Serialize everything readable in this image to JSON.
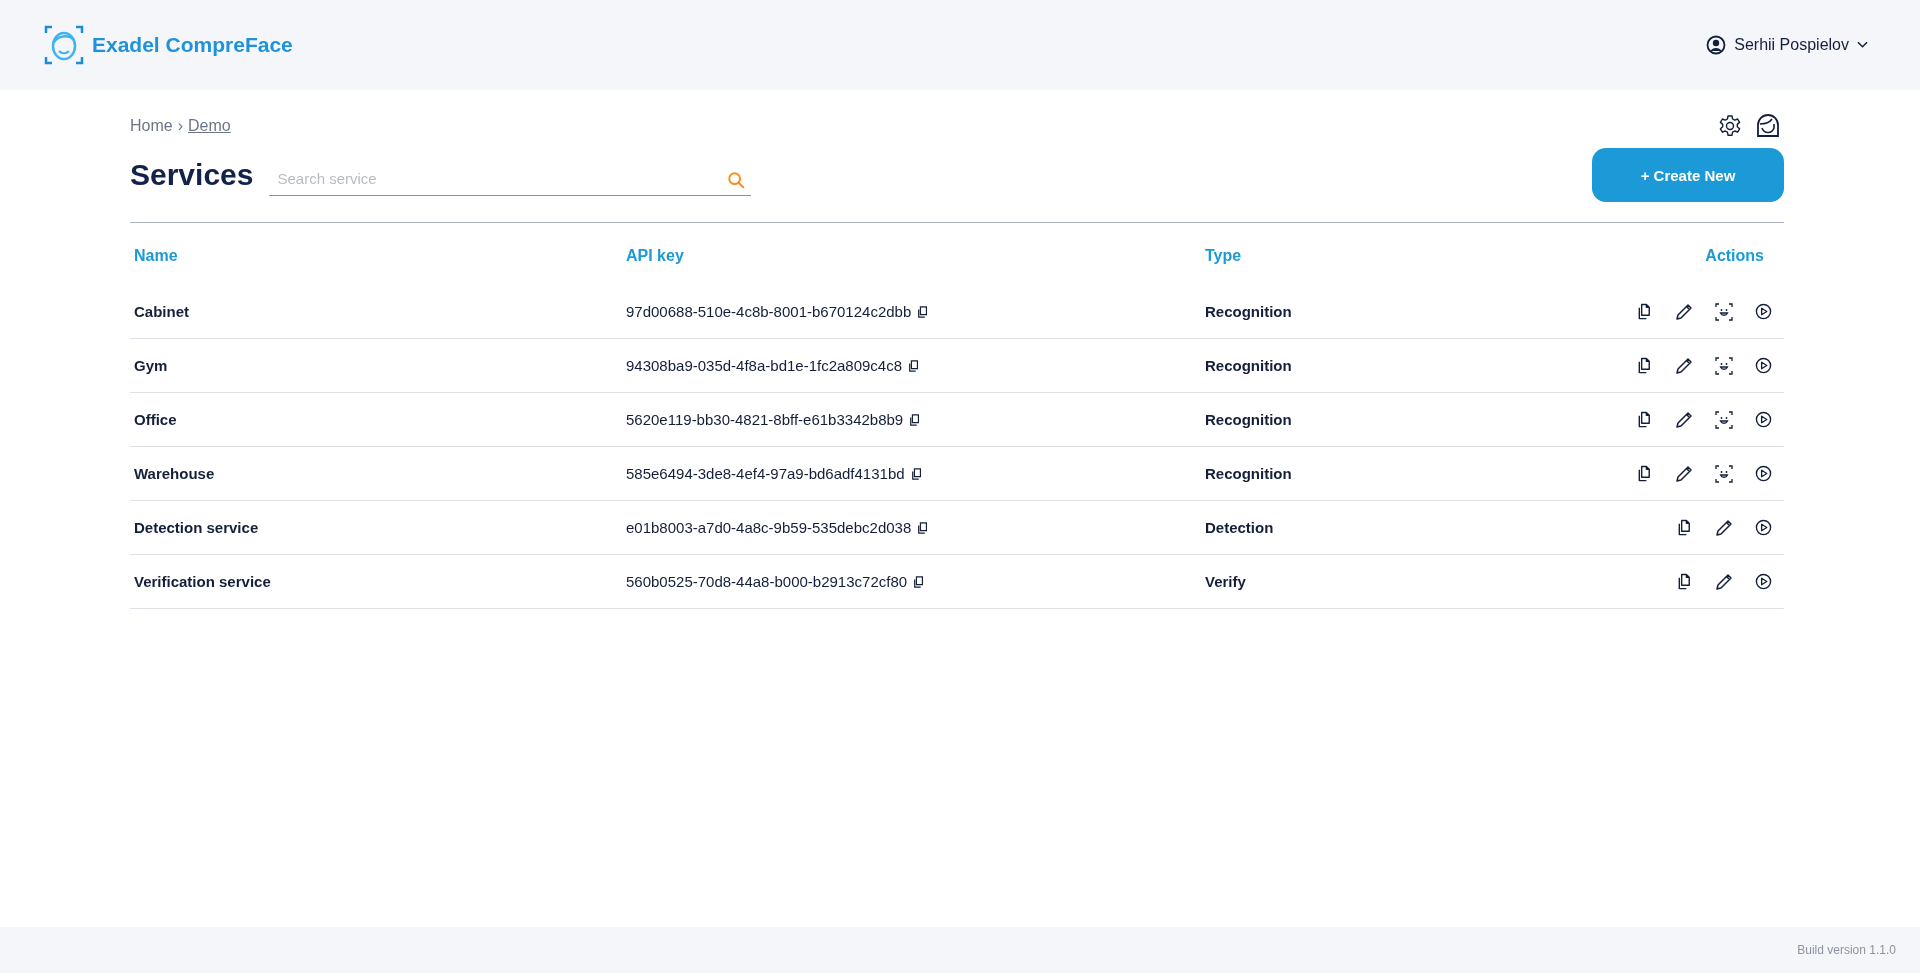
{
  "header": {
    "brand": "Exadel CompreFace",
    "user": "Serhii Pospielov"
  },
  "breadcrumb": {
    "home": "Home",
    "separator": "›",
    "current": "Demo"
  },
  "title": "Services",
  "search": {
    "placeholder": "Search service"
  },
  "create_button": "+ Create New",
  "table": {
    "columns": [
      "Name",
      "API key",
      "Type",
      "Actions"
    ],
    "rows": [
      {
        "name": "Cabinet",
        "api_key": "97d00688-510e-4c8b-8001-b670124c2dbb",
        "type": "Recognition",
        "scan_action": true
      },
      {
        "name": "Gym",
        "api_key": "94308ba9-035d-4f8a-bd1e-1fc2a809c4c8",
        "type": "Recognition",
        "scan_action": true
      },
      {
        "name": "Office",
        "api_key": "5620e119-bb30-4821-8bff-e61b3342b8b9",
        "type": "Recognition",
        "scan_action": true
      },
      {
        "name": "Warehouse",
        "api_key": "585e6494-3de8-4ef4-97a9-bd6adf4131bd",
        "type": "Recognition",
        "scan_action": true
      },
      {
        "name": "Detection service",
        "api_key": "e01b8003-a7d0-4a8c-9b59-535debc2d038",
        "type": "Detection",
        "scan_action": false
      },
      {
        "name": "Verification service",
        "api_key": "560b0525-70d8-44a8-b000-b2913c72cf80",
        "type": "Verify",
        "scan_action": false
      }
    ]
  },
  "footer": "Build version 1.1.0"
}
